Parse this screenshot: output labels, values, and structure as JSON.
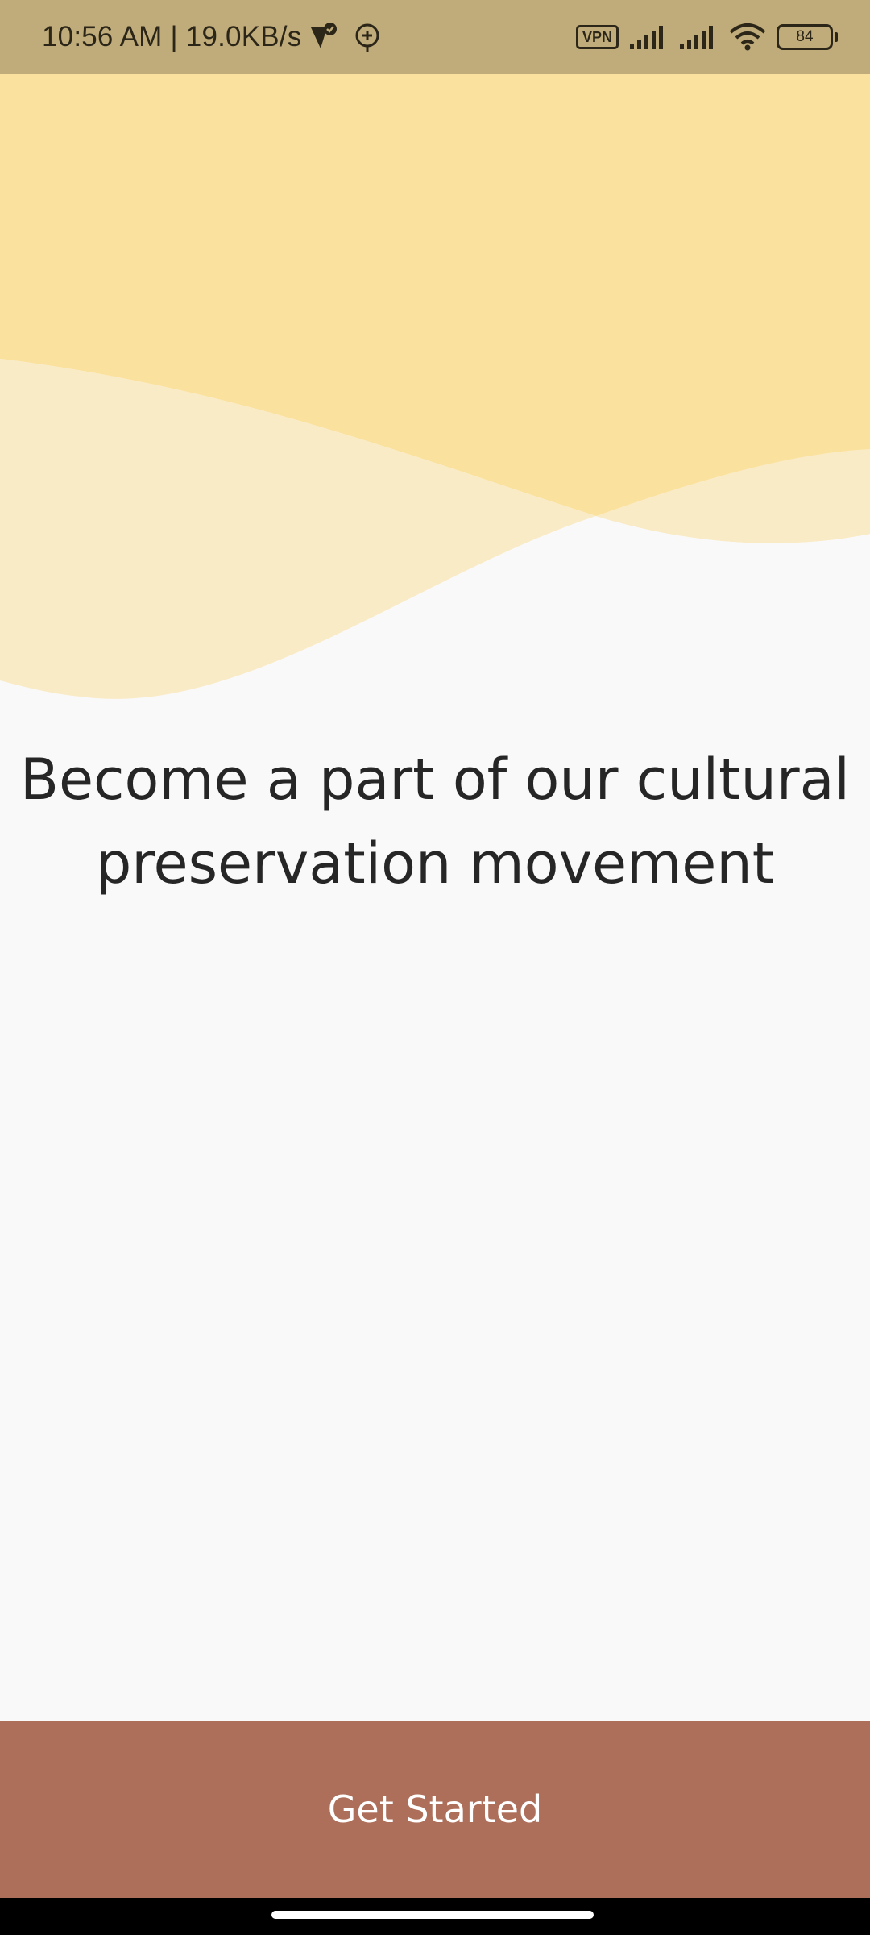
{
  "status_bar": {
    "time": "10:56 AM",
    "separator": "|",
    "network_speed": "19.0KB/s",
    "vpn_label": "VPN",
    "battery_level": "84",
    "icons": [
      "check-shield-icon",
      "location-plus-icon",
      "signal-icon",
      "signal-icon",
      "wifi-icon",
      "battery-icon"
    ]
  },
  "onboarding": {
    "headline": "Become a part of our cultural preservation movement",
    "cta_label": "Get Started"
  },
  "colors": {
    "status_bar_bg": "#c0ac7a",
    "wave_primary": "#fae29e",
    "wave_secondary": "#faebc7",
    "background": "#f9f9f9",
    "cta_bg": "#ad6f5a",
    "cta_text": "#ffffff",
    "headline_text": "#262626"
  }
}
